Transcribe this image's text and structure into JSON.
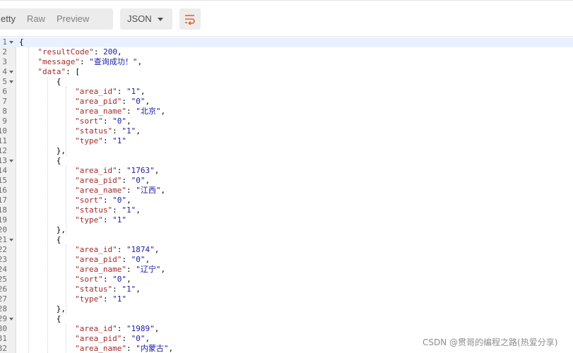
{
  "toolbar": {
    "view_tabs": {
      "pretty": "etty",
      "raw": "Raw",
      "preview": "Preview"
    },
    "format_select": {
      "value": "JSON"
    },
    "wrap_icon": "wrap-lines-icon",
    "accent_color": "#e8632a"
  },
  "editor": {
    "lines": [
      {
        "n": "1",
        "fold": true,
        "indent": 0,
        "key": "",
        "val": "",
        "raw": "{"
      },
      {
        "n": "2",
        "fold": false,
        "indent": 1,
        "key": "\"resultCode\"",
        "val": "200",
        "vtype": "n",
        "tail": ","
      },
      {
        "n": "3",
        "fold": false,
        "indent": 1,
        "key": "\"message\"",
        "val": "\"查询成功！\"",
        "vtype": "s",
        "tail": ","
      },
      {
        "n": "4",
        "fold": true,
        "indent": 1,
        "key": "\"data\"",
        "val": "[",
        "vtype": "p",
        "tail": ""
      },
      {
        "n": "5",
        "fold": true,
        "indent": 2,
        "raw": "{"
      },
      {
        "n": "6",
        "fold": false,
        "indent": 3,
        "key": "\"area_id\"",
        "val": "\"1\"",
        "vtype": "s",
        "tail": ","
      },
      {
        "n": "7",
        "fold": false,
        "indent": 3,
        "key": "\"area_pid\"",
        "val": "\"0\"",
        "vtype": "s",
        "tail": ","
      },
      {
        "n": "8",
        "fold": false,
        "indent": 3,
        "key": "\"area_name\"",
        "val": "\"北京\"",
        "vtype": "s",
        "tail": ","
      },
      {
        "n": "9",
        "fold": false,
        "indent": 3,
        "key": "\"sort\"",
        "val": "\"0\"",
        "vtype": "s",
        "tail": ","
      },
      {
        "n": "10",
        "fold": false,
        "indent": 3,
        "key": "\"status\"",
        "val": "\"1\"",
        "vtype": "s",
        "tail": ","
      },
      {
        "n": "11",
        "fold": false,
        "indent": 3,
        "key": "\"type\"",
        "val": "\"1\"",
        "vtype": "s",
        "tail": ""
      },
      {
        "n": "12",
        "fold": false,
        "indent": 2,
        "raw": "},"
      },
      {
        "n": "13",
        "fold": true,
        "indent": 2,
        "raw": "{"
      },
      {
        "n": "14",
        "fold": false,
        "indent": 3,
        "key": "\"area_id\"",
        "val": "\"1763\"",
        "vtype": "s",
        "tail": ","
      },
      {
        "n": "15",
        "fold": false,
        "indent": 3,
        "key": "\"area_pid\"",
        "val": "\"0\"",
        "vtype": "s",
        "tail": ","
      },
      {
        "n": "16",
        "fold": false,
        "indent": 3,
        "key": "\"area_name\"",
        "val": "\"江西\"",
        "vtype": "s",
        "tail": ","
      },
      {
        "n": "17",
        "fold": false,
        "indent": 3,
        "key": "\"sort\"",
        "val": "\"0\"",
        "vtype": "s",
        "tail": ","
      },
      {
        "n": "18",
        "fold": false,
        "indent": 3,
        "key": "\"status\"",
        "val": "\"1\"",
        "vtype": "s",
        "tail": ","
      },
      {
        "n": "19",
        "fold": false,
        "indent": 3,
        "key": "\"type\"",
        "val": "\"1\"",
        "vtype": "s",
        "tail": ""
      },
      {
        "n": "20",
        "fold": false,
        "indent": 2,
        "raw": "},"
      },
      {
        "n": "21",
        "fold": true,
        "indent": 2,
        "raw": "{"
      },
      {
        "n": "22",
        "fold": false,
        "indent": 3,
        "key": "\"area_id\"",
        "val": "\"1874\"",
        "vtype": "s",
        "tail": ","
      },
      {
        "n": "23",
        "fold": false,
        "indent": 3,
        "key": "\"area_pid\"",
        "val": "\"0\"",
        "vtype": "s",
        "tail": ","
      },
      {
        "n": "24",
        "fold": false,
        "indent": 3,
        "key": "\"area_name\"",
        "val": "\"辽宁\"",
        "vtype": "s",
        "tail": ","
      },
      {
        "n": "25",
        "fold": false,
        "indent": 3,
        "key": "\"sort\"",
        "val": "\"0\"",
        "vtype": "s",
        "tail": ","
      },
      {
        "n": "26",
        "fold": false,
        "indent": 3,
        "key": "\"status\"",
        "val": "\"1\"",
        "vtype": "s",
        "tail": ","
      },
      {
        "n": "27",
        "fold": false,
        "indent": 3,
        "key": "\"type\"",
        "val": "\"1\"",
        "vtype": "s",
        "tail": ""
      },
      {
        "n": "28",
        "fold": false,
        "indent": 2,
        "raw": "},"
      },
      {
        "n": "29",
        "fold": true,
        "indent": 2,
        "raw": "{"
      },
      {
        "n": "30",
        "fold": false,
        "indent": 3,
        "key": "\"area_id\"",
        "val": "\"1989\"",
        "vtype": "s",
        "tail": ","
      },
      {
        "n": "31",
        "fold": false,
        "indent": 3,
        "key": "\"area_pid\"",
        "val": "\"0\"",
        "vtype": "s",
        "tail": ","
      },
      {
        "n": "32",
        "fold": false,
        "indent": 3,
        "key": "\"area_name\"",
        "val": "\"内蒙古\"",
        "vtype": "s",
        "tail": ","
      }
    ]
  },
  "watermark": "CSDN @贯哥的编程之路(热爱分享)"
}
